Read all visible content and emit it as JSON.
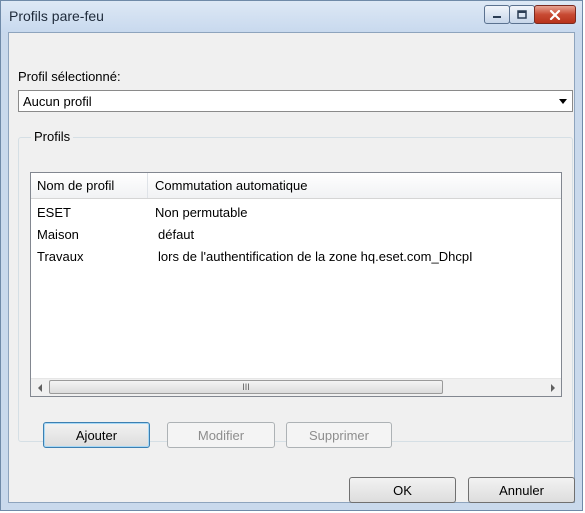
{
  "window": {
    "title": "Profils pare-feu"
  },
  "profile_selector": {
    "label": "Profil sélectionné:",
    "selected_value": "Aucun profil"
  },
  "profiles_group": {
    "legend": "Profils",
    "columns": [
      "Nom de profil",
      "Commutation automatique"
    ],
    "rows": [
      {
        "name": "ESET",
        "switching": "Non permutable"
      },
      {
        "name": "Maison",
        "switching": "défaut"
      },
      {
        "name": "Travaux",
        "switching": "lors de l'authentification de la zone hq.eset.com_DhcpI"
      }
    ],
    "scrollbar_thumb_glyph": "III"
  },
  "buttons": {
    "add": "Ajouter",
    "edit": "Modifier",
    "delete": "Supprimer",
    "ok": "OK",
    "cancel": "Annuler"
  },
  "colors": {
    "close_button": "#c84a33",
    "default_button_border": "#3c7fb1"
  }
}
